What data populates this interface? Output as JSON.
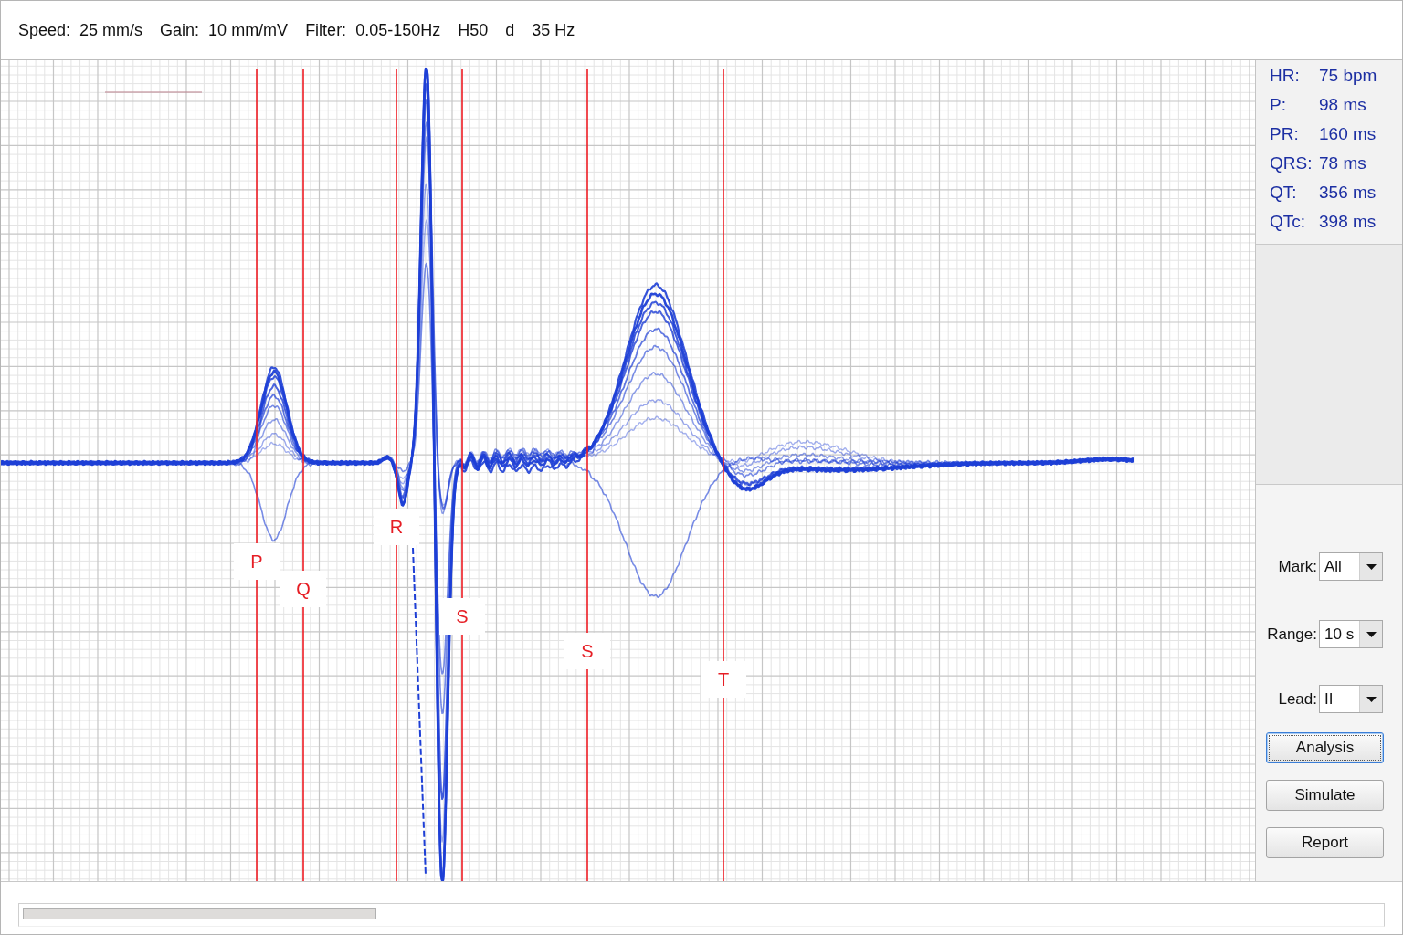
{
  "top_bar": {
    "settings": [
      {
        "label": "Speed:",
        "value": "25 mm/s"
      },
      {
        "label": "Gain:",
        "value": "10 mm/mV"
      },
      {
        "label": "Filter:",
        "value": "0.05-150Hz"
      }
    ],
    "filter_options": [
      "H50",
      "d",
      "35 Hz"
    ]
  },
  "ecg": {
    "markers": [
      {
        "label": "P"
      },
      {
        "label": "Q"
      },
      {
        "label": "R"
      },
      {
        "label": "S"
      },
      {
        "label": "S"
      },
      {
        "label": "T"
      }
    ]
  },
  "measurements": [
    {
      "label": "HR:",
      "value": "75 bpm"
    },
    {
      "label": "P:",
      "value": "98 ms"
    },
    {
      "label": "PR:",
      "value": "160 ms"
    },
    {
      "label": "QRS:",
      "value": "78 ms"
    },
    {
      "label": "QT:",
      "value": "356 ms"
    },
    {
      "label": "QTc:",
      "value": "398 ms"
    }
  ],
  "controls": {
    "dropdowns": [
      {
        "label": "Mark:",
        "value": "All"
      },
      {
        "label": "Range:",
        "value": "10 s"
      },
      {
        "label": "Lead:",
        "value": "II"
      }
    ],
    "buttons": [
      {
        "label": "Analysis",
        "focused": true
      },
      {
        "label": "Simulate",
        "focused": false
      },
      {
        "label": "Report",
        "focused": false
      }
    ]
  }
}
